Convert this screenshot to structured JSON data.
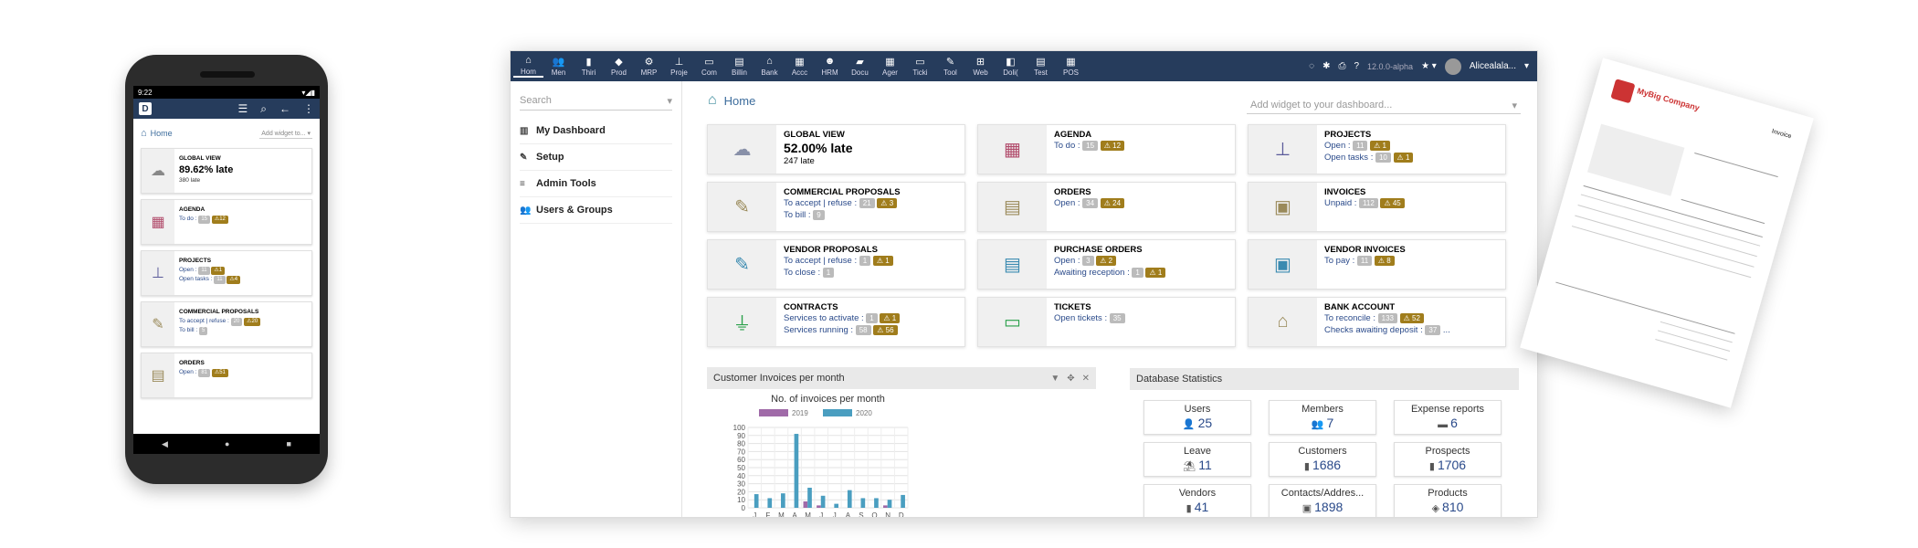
{
  "phone": {
    "time": "9:22",
    "home_label": "Home",
    "add_widget": "Add widget to...",
    "cards": [
      {
        "title": "GLOBAL VIEW",
        "big": "89.62% late",
        "sub": "380 late",
        "icon": "cloud"
      },
      {
        "title": "AGENDA",
        "line1": "To do :",
        "b1": "15",
        "w1": "12",
        "icon": "calendar"
      },
      {
        "title": "PROJECTS",
        "line1": "Open :",
        "b1": "11",
        "w1": "1",
        "line2": "Open tasks :",
        "b2": "11",
        "w2": "4",
        "icon": "sitemap"
      },
      {
        "title": "COMMERCIAL PROPOSALS",
        "line1": "To accept | refuse :",
        "b1": "20",
        "w1": "20",
        "line2": "To bill :",
        "b2": "5",
        "icon": "proposal"
      },
      {
        "title": "ORDERS",
        "line1": "Open :",
        "b1": "81",
        "w1": "51",
        "icon": "order"
      }
    ]
  },
  "topmenu": [
    {
      "label": "Hom",
      "icon": "home"
    },
    {
      "label": "Men",
      "icon": "members"
    },
    {
      "label": "Thiri",
      "icon": "thirdparty"
    },
    {
      "label": "Prod",
      "icon": "product"
    },
    {
      "label": "MRP",
      "icon": "mrp"
    },
    {
      "label": "Proje",
      "icon": "project"
    },
    {
      "label": "Com",
      "icon": "commercial"
    },
    {
      "label": "Billin",
      "icon": "billing"
    },
    {
      "label": "Bank",
      "icon": "bank"
    },
    {
      "label": "Accc",
      "icon": "accounting"
    },
    {
      "label": "HRM",
      "icon": "hrm"
    },
    {
      "label": "Docu",
      "icon": "documents"
    },
    {
      "label": "Ager",
      "icon": "agenda"
    },
    {
      "label": "Ticki",
      "icon": "ticket"
    },
    {
      "label": "Tool",
      "icon": "tools"
    },
    {
      "label": "Web",
      "icon": "website"
    },
    {
      "label": "Doli(",
      "icon": "dolibarr"
    },
    {
      "label": "Test",
      "icon": "test"
    },
    {
      "label": "POS",
      "icon": "pos"
    }
  ],
  "topright": {
    "version": "12.0.0-alpha",
    "user": "Alicealala..."
  },
  "sidebar": {
    "search_placeholder": "Search",
    "items": [
      {
        "label": "My Dashboard",
        "icon": "chart"
      },
      {
        "label": "Setup",
        "icon": "wrench"
      },
      {
        "label": "Admin Tools",
        "icon": "server"
      },
      {
        "label": "Users & Groups",
        "icon": "users"
      }
    ]
  },
  "main": {
    "title": "Home",
    "add_widget": "Add widget to your dashboard..."
  },
  "cards": {
    "global": {
      "title": "GLOBAL VIEW",
      "big": "52.00% late",
      "sub": "247 late"
    },
    "agenda": {
      "title": "AGENDA",
      "l1": "To do :",
      "b1": "15",
      "w1": "12"
    },
    "projects": {
      "title": "PROJECTS",
      "l1": "Open :",
      "b1": "11",
      "w1": "1",
      "l2": "Open tasks :",
      "b2": "10",
      "w2": "1"
    },
    "commercial": {
      "title": "COMMERCIAL PROPOSALS",
      "l1": "To accept | refuse :",
      "b1": "21",
      "w1": "3",
      "l2": "To bill :",
      "b2": "9"
    },
    "orders": {
      "title": "ORDERS",
      "l1": "Open :",
      "b1": "34",
      "w1": "24"
    },
    "invoices": {
      "title": "INVOICES",
      "l1": "Unpaid :",
      "b1": "112",
      "w1": "45"
    },
    "vproposals": {
      "title": "VENDOR PROPOSALS",
      "l1": "To accept | refuse :",
      "b1": "1",
      "w1": "1",
      "l2": "To close :",
      "b2": "1"
    },
    "porders": {
      "title": "PURCHASE ORDERS",
      "l1": "Open :",
      "b1": "3",
      "w1": "2",
      "l2": "Awaiting reception :",
      "b2": "1",
      "w2": "1"
    },
    "vinvoices": {
      "title": "VENDOR INVOICES",
      "l1": "To pay :",
      "b1": "11",
      "w1": "8"
    },
    "contracts": {
      "title": "CONTRACTS",
      "l1": "Services to activate :",
      "b1": "1",
      "w1": "1",
      "l2": "Services running :",
      "b2": "58",
      "w2": "56"
    },
    "tickets": {
      "title": "TICKETS",
      "l1": "Open tickets :",
      "b1": "35"
    },
    "bank": {
      "title": "BANK ACCOUNT",
      "l1": "To reconcile :",
      "b1": "133",
      "w1": "52",
      "l2": "Checks awaiting deposit :",
      "b2": "37",
      "l2tail": "..."
    }
  },
  "chart_panel_title": "Customer Invoices per month",
  "chart_data": {
    "type": "bar",
    "title": "No. of invoices per month",
    "categories": [
      "J",
      "F",
      "M",
      "A",
      "M",
      "J",
      "J",
      "A",
      "S",
      "O",
      "N",
      "D"
    ],
    "series": [
      {
        "name": "2019",
        "color": "#a06aa8",
        "values": [
          0,
          0,
          0,
          0,
          8,
          3,
          0,
          0,
          0,
          0,
          3,
          0
        ]
      },
      {
        "name": "2020",
        "color": "#4a9ec0",
        "values": [
          17,
          12,
          18,
          92,
          25,
          15,
          5,
          22,
          12,
          12,
          10,
          16
        ]
      }
    ],
    "yticks": [
      0,
      10,
      20,
      30,
      40,
      50,
      60,
      70,
      80,
      90,
      100
    ],
    "ylim": [
      0,
      100
    ]
  },
  "dbstats": {
    "title": "Database Statistics",
    "items": [
      {
        "label": "Users",
        "value": "25",
        "icon": "user"
      },
      {
        "label": "Members",
        "value": "7",
        "icon": "members"
      },
      {
        "label": "Expense reports",
        "value": "6",
        "icon": "expense"
      },
      {
        "label": "Leave",
        "value": "11",
        "icon": "beach"
      },
      {
        "label": "Customers",
        "value": "1686",
        "icon": "building"
      },
      {
        "label": "Prospects",
        "value": "1706",
        "icon": "building"
      },
      {
        "label": "Vendors",
        "value": "41",
        "icon": "building"
      },
      {
        "label": "Contacts/Addres...",
        "value": "1898",
        "icon": "contact"
      },
      {
        "label": "Products",
        "value": "810",
        "icon": "box"
      }
    ]
  },
  "invoice_doc": {
    "company": "MyBig Company",
    "doc_title": "Invoice"
  }
}
